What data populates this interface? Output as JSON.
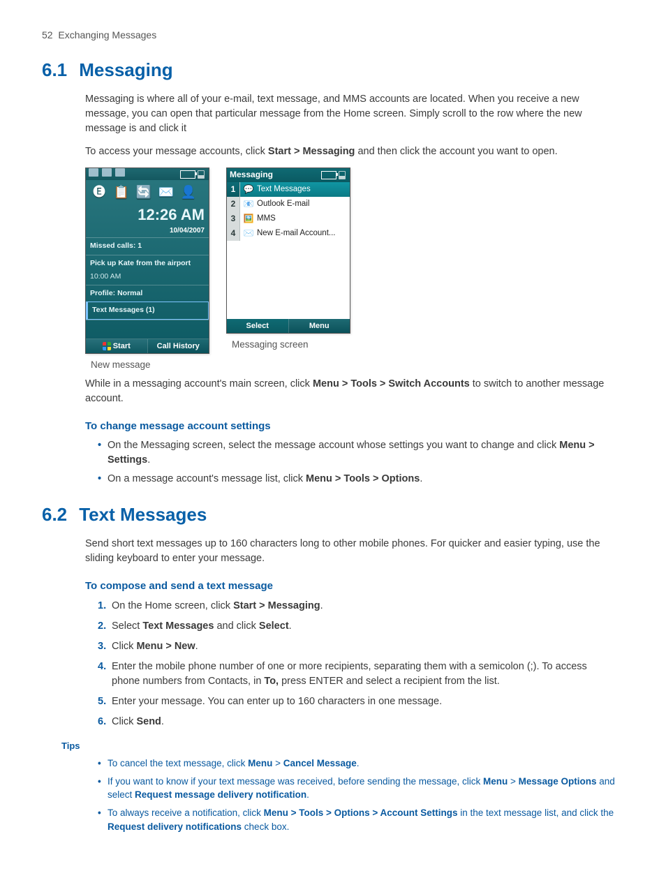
{
  "header": {
    "page_num": "52",
    "chapter": "Exchanging Messages"
  },
  "s61": {
    "num": "6.1",
    "title": "Messaging",
    "para1": "Messaging is where all of your e-mail, text message, and MMS accounts are located. When you receive a new message, you can open that particular message from the Home screen. Simply scroll to the row where the new message is and click it",
    "para2_pre": "To access your message accounts, click ",
    "para2_b": "Start > Messaging",
    "para2_post": " and then click the account you want to open.",
    "fig1": {
      "caption": "New message",
      "clock_time": "12:26 AM",
      "clock_date": "10/04/2007",
      "rows": {
        "missed": "Missed calls: 1",
        "task": "Pick up Kate from the airport",
        "task_time": "10:00 AM",
        "profile": "Profile: Normal",
        "txtmsg": "Text Messages (1)"
      },
      "soft_left": "Start",
      "soft_right": "Call History"
    },
    "fig2": {
      "caption": "Messaging screen",
      "titlebar": "Messaging",
      "items": [
        {
          "n": "1",
          "label": "Text Messages",
          "selected": true
        },
        {
          "n": "2",
          "label": "Outlook E-mail",
          "selected": false
        },
        {
          "n": "3",
          "label": "MMS",
          "selected": false
        },
        {
          "n": "4",
          "label": "New E-mail Account...",
          "selected": false
        }
      ],
      "soft_left": "Select",
      "soft_right": "Menu"
    },
    "para3_pre": "While in a messaging account's main screen, click ",
    "para3_b": "Menu > Tools > Switch Accounts",
    "para3_post": " to switch to another message account.",
    "sub1": "To change message account settings",
    "bullets": {
      "b1_pre": "On the Messaging screen, select the message account whose settings you want to change and click ",
      "b1_b": "Menu > Settings",
      "b1_post": ".",
      "b2_pre": "On a message account's message list, click ",
      "b2_b": "Menu > Tools > Options",
      "b2_post": "."
    }
  },
  "s62": {
    "num": "6.2",
    "title": "Text Messages",
    "para1": "Send short text messages up to 160 characters long to other mobile phones. For quicker and easier typing, use the sliding keyboard to enter your message.",
    "sub1": "To compose and send a text message",
    "steps": {
      "s1_pre": "On the Home screen, click ",
      "s1_b": "Start > Messaging",
      "s1_post": ".",
      "s2_pre": "Select ",
      "s2_b1": "Text Messages",
      "s2_mid": " and click ",
      "s2_b2": "Select",
      "s2_post": ".",
      "s3_pre": "Click ",
      "s3_b": "Menu > New",
      "s3_post": ".",
      "s4_pre": "Enter the mobile phone number of one or more recipients, separating them with a semicolon (;). To access phone numbers from Contacts, in ",
      "s4_b": "To,",
      "s4_post": " press ENTER and select a recipient from the list.",
      "s5": "Enter your message. You can enter up to 160 characters in one message.",
      "s6_pre": "Click ",
      "s6_b": "Send",
      "s6_post": "."
    },
    "tips_label": "Tips",
    "tips": {
      "t1_pre": "To cancel the text message, click ",
      "t1_b1": "Menu",
      "t1_gt1": " > ",
      "t1_b2": "Cancel Message",
      "t1_post": ".",
      "t2_pre": "If you want to know if your text message was received, before sending the message, click ",
      "t2_b1": "Menu",
      "t2_gt1": " > ",
      "t2_b2": "Message Options",
      "t2_mid": " and select ",
      "t2_b3": "Request message delivery notification",
      "t2_post": ".",
      "t3_pre": "To always receive a notification, click ",
      "t3_b1": "Menu > Tools > Options > Account Settings",
      "t3_mid": " in the text message list, and click the ",
      "t3_b2": "Request delivery notifications",
      "t3_post": " check box."
    }
  }
}
